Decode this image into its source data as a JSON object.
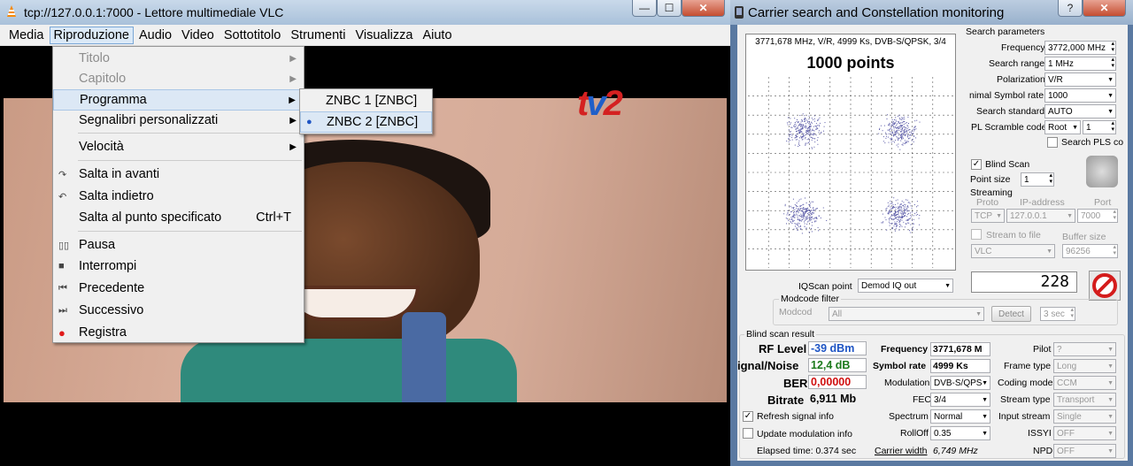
{
  "vlc": {
    "title": "tcp://127.0.0.1:7000 - Lettore multimediale VLC",
    "win_min": "—",
    "win_max": "☐",
    "win_close": "✕",
    "menu": [
      "Media",
      "Riproduzione",
      "Audio",
      "Video",
      "Sottotitolo",
      "Strumenti",
      "Visualizza",
      "Aiuto"
    ],
    "logo_t": "t",
    "logo_v": "v",
    "logo_2": "2",
    "playback_menu": [
      {
        "label": "Titolo",
        "disabled": true,
        "submenu": true
      },
      {
        "label": "Capitolo",
        "disabled": true,
        "submenu": true
      },
      {
        "label": "Programma",
        "submenu": true,
        "highlighted": true
      },
      {
        "label": "Segnalibri personalizzati",
        "submenu": true
      },
      {
        "label": "Velocità",
        "submenu": true
      },
      {
        "label": "Salta in avanti"
      },
      {
        "label": "Salta indietro"
      },
      {
        "label": "Salta al punto specificato",
        "shortcut": "Ctrl+T"
      },
      {
        "label": "Pausa"
      },
      {
        "label": "Interrompi"
      },
      {
        "label": "Precedente"
      },
      {
        "label": "Successivo"
      },
      {
        "label": "Registra"
      }
    ],
    "program_submenu": [
      {
        "label": "ZNBC 1 [ZNBC]",
        "selected": false
      },
      {
        "label": "ZNBC 2 [ZNBC]",
        "selected": true
      }
    ]
  },
  "cs": {
    "title": "Carrier search and Constellation monitoring",
    "help": "?",
    "close": "✕",
    "plot_caption": "3771,678 MHz, V/R, 4999 Ks, DVB-S/QPSK, 3/4",
    "plot_points": "1000 points",
    "search_params": "Search parameters",
    "frequency_label": "Frequency",
    "frequency": "3772,000 MHz",
    "search_range_label": "Search range",
    "search_range": "1 MHz",
    "polarization_label": "Polarization",
    "polarization": "V/R",
    "min_sr_label": "nimal Symbol rate",
    "min_sr": "1000",
    "search_std_label": "Search standard",
    "search_std": "AUTO",
    "pls_label": "PL Scramble code",
    "pls_mode": "Root",
    "pls_value": "1",
    "search_pls": "Search PLS co",
    "blind_scan": "Blind Scan",
    "point_size_label": "Point size",
    "point_size": "1",
    "streaming": "Streaming",
    "proto_h": "Proto",
    "ip_h": "IP-address",
    "port_h": "Port",
    "proto": "TCP",
    "ip": "127.0.0.1",
    "port": "7000",
    "stream_file": "Stream to file",
    "buffer_h": "Buffer size",
    "player": "VLC",
    "buffer": "96256",
    "iq_label": "IQScan point",
    "iq": "Demod IQ out",
    "counter": "228",
    "modcode_filter": "Modcode filter",
    "modcode_lbl": "Modcod",
    "modcode": "All",
    "detect": "Detect",
    "detect_time": "3 sec",
    "bs_result": "Blind scan result",
    "rf_label": "RF Level",
    "rf": "-39 dBm",
    "sn_label": "ignal/Noise",
    "sn": "12,4 dB",
    "ber_label": "BER",
    "ber": "0,00000",
    "bitrate_label": "Bitrate",
    "bitrate": "6,911 Mb",
    "freq_r_label": "Frequency",
    "freq_r": "3771,678 M",
    "sr_label": "Symbol rate",
    "sr": "4999 Ks",
    "mod_label": "Modulation",
    "mod": "DVB-S/QPS",
    "fec_label": "FEC",
    "fec": "3/4",
    "spec_label": "Spectrum",
    "spec": "Normal",
    "rolloff_label": "RollOff",
    "rolloff": "0.35",
    "pilot_label": "Pilot",
    "pilot": "?",
    "frame_label": "Frame type",
    "frame": "Long",
    "coding_label": "Coding mode",
    "coding": "CCM",
    "stype_label": "Stream type",
    "stype": "Transport",
    "input_label": "Input stream",
    "input": "Single",
    "issyi_label": "ISSYI",
    "issyi": "OFF",
    "npd_label": "NPD",
    "npd": "OFF",
    "refresh": "Refresh signal info",
    "update_mod": "Update modulation info",
    "elapsed": "Elapsed time: 0.374 sec",
    "cw_label": "Carrier width",
    "cw": "6,749 MHz",
    "colors": {
      "rf": "#1f55c4",
      "sn": "#1b7a1b",
      "ber": "#d01010",
      "points": "#5a5aa8"
    }
  }
}
